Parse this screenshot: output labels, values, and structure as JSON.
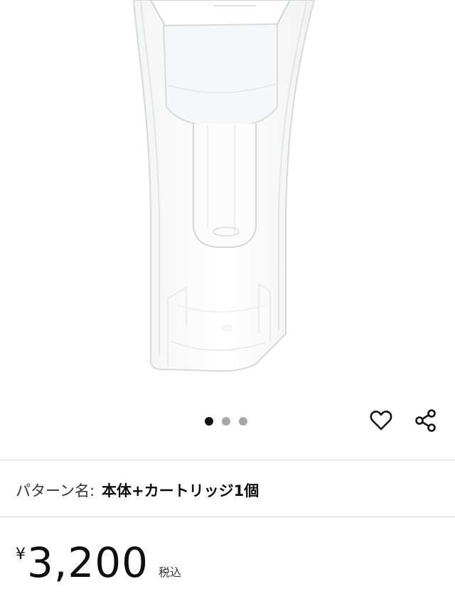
{
  "product_image": {
    "icon": "water-pitcher-image"
  },
  "carousel": {
    "dot_count": 3,
    "active_index": 0
  },
  "actions": {
    "wishlist_icon": "heart-icon",
    "share_icon": "share-icon"
  },
  "pattern": {
    "label": "パターン名:",
    "value": "本体+カートリッジ1個"
  },
  "price": {
    "currency": "¥",
    "amount": "3,200",
    "tax_note": "税込"
  },
  "colors": {
    "active_dot": "#111111",
    "inactive_dot": "#a7a7a7",
    "divider": "#cfd3d4",
    "text": "#0f1111"
  }
}
